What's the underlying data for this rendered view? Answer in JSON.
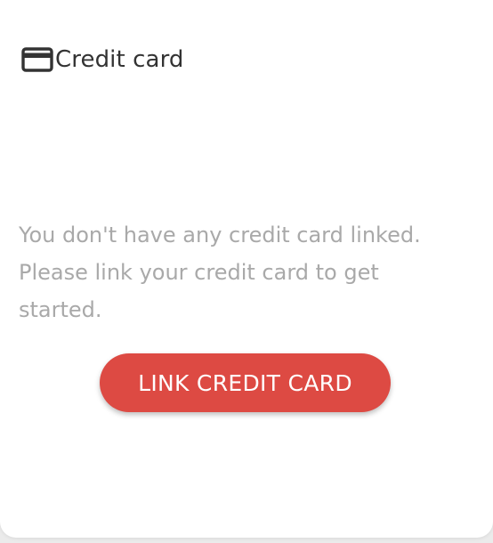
{
  "header": {
    "icon": "credit-card-icon",
    "title": "Credit card"
  },
  "empty_state": {
    "message": "You don't have any credit card linked. Please link your credit card to get started."
  },
  "actions": {
    "link_label": "LINK CREDIT CARD"
  },
  "colors": {
    "accent": "#dd4a43",
    "title_text": "#333333",
    "muted_text": "#a9a9a9"
  }
}
